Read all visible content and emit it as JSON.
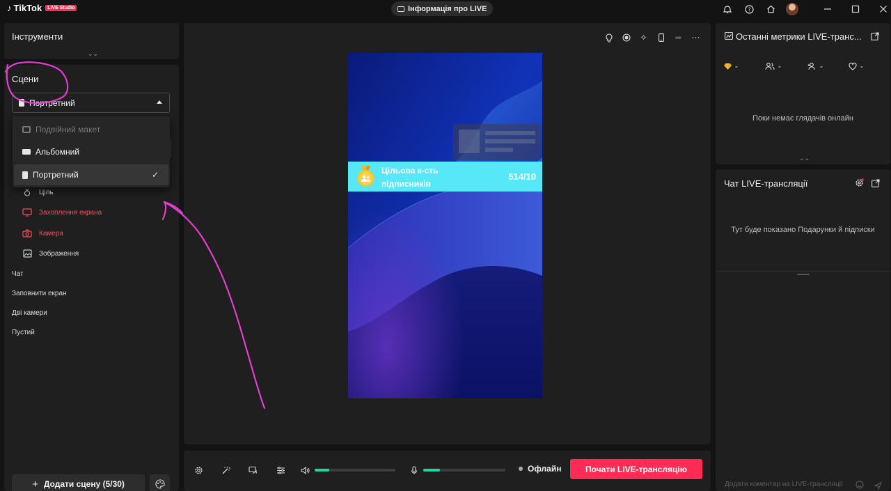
{
  "app": {
    "brand": "TikTok",
    "studio_badge": "LIVE Studio",
    "live_info_label": "Інформація про LIVE"
  },
  "titlebar_icons": [
    "bell-icon",
    "help-icon",
    "home-icon",
    "avatar",
    "minimize-icon",
    "maximize-icon",
    "close-icon"
  ],
  "tools": {
    "title": "Інструменти"
  },
  "scenes": {
    "title": "Сцени",
    "selected_layout": "Портретний",
    "layout_options": [
      {
        "label": "Подвійний макет",
        "disabled": true,
        "selected": false
      },
      {
        "label": "Альбомний",
        "disabled": false,
        "selected": false
      },
      {
        "label": "Портретний",
        "disabled": false,
        "selected": true
      }
    ],
    "sources": [
      {
        "label": "Ціль",
        "icon": "medal-icon",
        "color": "#dcdcdc"
      },
      {
        "label": "Захоплення екрана",
        "icon": "monitor-icon",
        "color": "#ff4a5d"
      },
      {
        "label": "Камера",
        "icon": "camera-icon",
        "color": "#ff4a5d"
      },
      {
        "label": "Зображення",
        "icon": "image-icon",
        "color": "#dcdcdc"
      }
    ],
    "scene_list": [
      "Чат",
      "Заповнити екран",
      "Дві камери",
      "Пустий"
    ],
    "add_scene_label": "Додати сцену (5/30)"
  },
  "preview": {
    "goal": {
      "title": "Цільова к-сть підписників",
      "count": "514/10"
    }
  },
  "controls": {
    "speaker_volume": 0.18,
    "mic_volume": 0.2,
    "status_label": "Офлайн",
    "go_live_label": "Почати LIVE-трансляцію",
    "accent_color": "#fe2c55",
    "level_color": "#20d5a2"
  },
  "metrics": {
    "title": "Останні метрики LIVE-транс...",
    "items": [
      {
        "icon": "diamond-icon",
        "value": "-"
      },
      {
        "icon": "viewers-icon",
        "value": "-"
      },
      {
        "icon": "new-follower-icon",
        "value": "-"
      },
      {
        "icon": "heart-icon",
        "value": "-"
      }
    ],
    "empty_text": "Поки немає глядачів онлайн"
  },
  "chat": {
    "title": "Чат LIVE-трансляції",
    "empty_text": "Тут буде показано Подарунки й підписки",
    "input_placeholder": "Додати коментар на LIVE-трансляції"
  }
}
